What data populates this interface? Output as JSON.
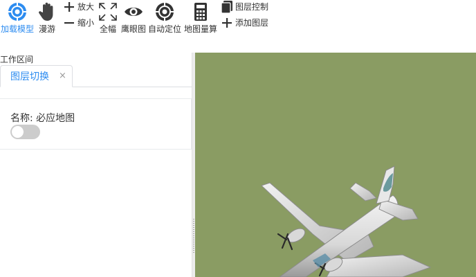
{
  "toolbar": {
    "load_model": "加载模型",
    "roam": "漫游",
    "zoom_in": "放大",
    "zoom_out": "缩小",
    "full_extent": "全幅",
    "eagle_eye": "鹰眼图",
    "auto_locate": "自动定位",
    "measure": "地图量算",
    "layer_control": "图层控制",
    "add_layer": "添加图层"
  },
  "workspace": {
    "label": "工作区间",
    "tab_label": "图层切换",
    "tab_close": "×",
    "layer_name": "名称: 必应地图",
    "toggle_on": false
  },
  "colors": {
    "accent": "#2d8cf0",
    "map_background": "#8a9c63",
    "toggle_off": "#cccccc"
  },
  "icons": {
    "load_model": "crosshair-target-icon",
    "roam": "hand-icon",
    "zoom_in": "plus-icon",
    "zoom_out": "minus-icon",
    "full_extent": "expand-arrows-icon",
    "eagle_eye": "eye-icon",
    "auto_locate": "locate-target-icon",
    "measure": "calculator-icon",
    "layer_control": "layers-icon",
    "add_layer": "plus-icon"
  }
}
